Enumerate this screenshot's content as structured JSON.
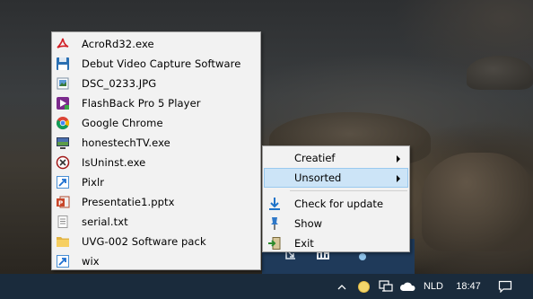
{
  "file_menu": {
    "items": [
      {
        "label": "AcroRd32.exe",
        "icon": "acrobat-reader-icon"
      },
      {
        "label": "Debut Video Capture Software",
        "icon": "floppy-disk-icon"
      },
      {
        "label": "DSC_0233.JPG",
        "icon": "image-file-icon"
      },
      {
        "label": "FlashBack Pro 5 Player",
        "icon": "flashback-player-icon"
      },
      {
        "label": "Google Chrome",
        "icon": "chrome-icon"
      },
      {
        "label": "honestechTV.exe",
        "icon": "tv-app-icon"
      },
      {
        "label": "IsUninst.exe",
        "icon": "uninstaller-icon"
      },
      {
        "label": "Pixlr",
        "icon": "shortcut-icon"
      },
      {
        "label": "Presentatie1.pptx",
        "icon": "powerpoint-file-icon"
      },
      {
        "label": "serial.txt",
        "icon": "text-file-icon"
      },
      {
        "label": "UVG-002 Software pack",
        "icon": "folder-icon"
      },
      {
        "label": "wix",
        "icon": "shortcut-icon"
      }
    ]
  },
  "context_menu": {
    "items": [
      {
        "label": "Creatief",
        "submenu": true
      },
      {
        "label": "Unsorted",
        "submenu": true,
        "selected": true
      },
      {
        "label": "Check for update",
        "icon": "download-arrow-icon"
      },
      {
        "label": "Show",
        "icon": "pin-icon"
      },
      {
        "label": "Exit",
        "icon": "exit-icon"
      }
    ]
  },
  "taskbar": {
    "language": "NLD",
    "time": "18:47"
  },
  "colors": {
    "taskbar": "#1a2b3c",
    "menu_bg": "#f2f2f2",
    "selected_bg": "#cce4f7",
    "selected_border": "#99c9ef"
  }
}
